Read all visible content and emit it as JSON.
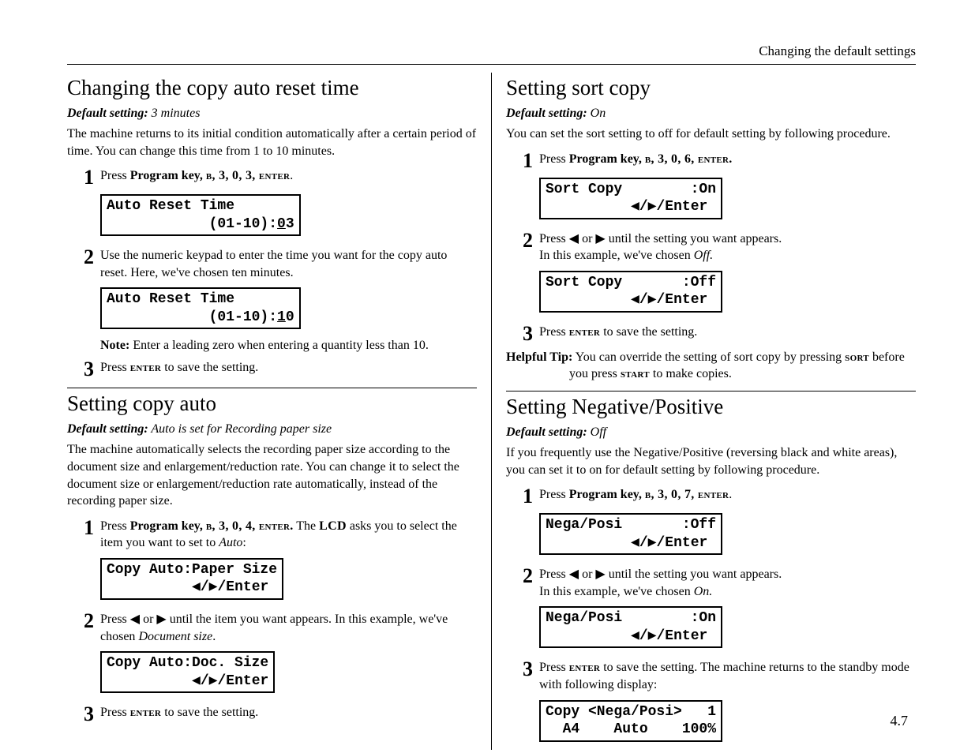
{
  "header": "Changing the default settings",
  "footer": "4.7",
  "left": {
    "s1": {
      "title": "Changing the copy auto reset time",
      "def_label": "Default setting:",
      "def_value": " 3 minutes",
      "intro": "The machine returns to its initial condition automatically after a certain period of time. You can change this time from 1 to 10 minutes.",
      "step1_pre": "Press ",
      "step1_bold": "Program key, ",
      "step1_sc": "b, 3, 0, 3, enter",
      "step1_post": ".",
      "lcd1a": "Auto Reset Time",
      "lcd1b_pre": "            (01-10):",
      "lcd1b_u": "0",
      "lcd1b_post": "3",
      "step2": "Use the numeric keypad to enter the time you want for the copy auto reset. Here, we've chosen ten minutes.",
      "lcd2a": "Auto Reset Time",
      "lcd2b_pre": "            (01-10):",
      "lcd2b_u": "1",
      "lcd2b_post": "0",
      "note_label": "Note:",
      "note_text": "  Enter a leading zero when entering a quantity less than 10.",
      "step3_pre": "Press ",
      "step3_sc": "enter",
      "step3_post": " to save the setting."
    },
    "s2": {
      "title": "Setting copy auto",
      "def_label": "Default setting:",
      "def_value": " Auto is set for Recording paper size",
      "intro": "The machine automatically selects the recording paper size according to the document size and enlargement/reduction rate. You can change it to select the document size or enlargement/reduction rate automatically, instead of the recording paper size.",
      "step1_pre": "Press ",
      "step1_bold": "Program key, ",
      "step1_sc": "b, 3, 0, 4, enter.",
      "step1_post": " The ",
      "step1_post2": "LCD",
      "step1_post3": " asks you to select the item you want to set to ",
      "step1_i": "Auto",
      "step1_post4": ":",
      "lcd1": "Copy Auto:Paper Size\n          ◀/▶/Enter",
      "step2_pre": "Press ◀ or ▶ until the item you want appears. In this example, we've chosen ",
      "step2_i": "Document size",
      "step2_post": ".",
      "lcd2": "Copy Auto:Doc. Size\n          ◀/▶/Enter",
      "step3_pre": "Press ",
      "step3_sc": "enter",
      "step3_post": " to save the setting."
    }
  },
  "right": {
    "s1": {
      "title": "Setting sort copy",
      "def_label": "Default setting:",
      "def_value": " On",
      "intro": "You can set the sort setting to off for default setting by following procedure.",
      "step1_pre": "Press ",
      "step1_bold": "Program key, ",
      "step1_sc": "b, 3, 0, 6, enter.",
      "lcd1": "Sort Copy        :On\n          ◀/▶/Enter",
      "step2_pre": "Press ◀ or ▶ until the setting you want appears.",
      "step2_line2_pre": "In this example, we've chosen ",
      "step2_i": "Off.",
      "lcd2": "Sort Copy       :Off\n          ◀/▶/Enter",
      "step3_pre": "Press ",
      "step3_sc": "enter",
      "step3_post": " to save the setting.",
      "tip_label": "Helpful Tip:",
      "tip_text_pre": " You can override the setting of sort copy by pressing ",
      "tip_sc1": "sort",
      "tip_mid": " before you press ",
      "tip_sc2": "start",
      "tip_post": " to make copies."
    },
    "s2": {
      "title": "Setting Negative/Positive",
      "def_label": "Default setting:",
      "def_value": " Off",
      "intro": "If you frequently use the Negative/Positive (reversing black and white areas), you can set it to on for default setting by following procedure.",
      "step1_pre": "Press ",
      "step1_bold": "Program key, ",
      "step1_sc": "b, 3, 0, 7, enter",
      "step1_post": ".",
      "lcd1": "Nega/Posi       :Off\n          ◀/▶/Enter",
      "step2_pre": "Press ◀ or ▶ until the setting you want appears.",
      "step2_line2_pre": "In this example, we've chosen ",
      "step2_i": "On.",
      "lcd2": "Nega/Posi        :On\n          ◀/▶/Enter",
      "step3_pre": "Press ",
      "step3_sc": "enter",
      "step3_post": " to save the setting. The machine returns to the standby mode with following display:",
      "lcd3": "Copy <Nega/Posi>   1\n  A4    Auto    100%"
    }
  }
}
